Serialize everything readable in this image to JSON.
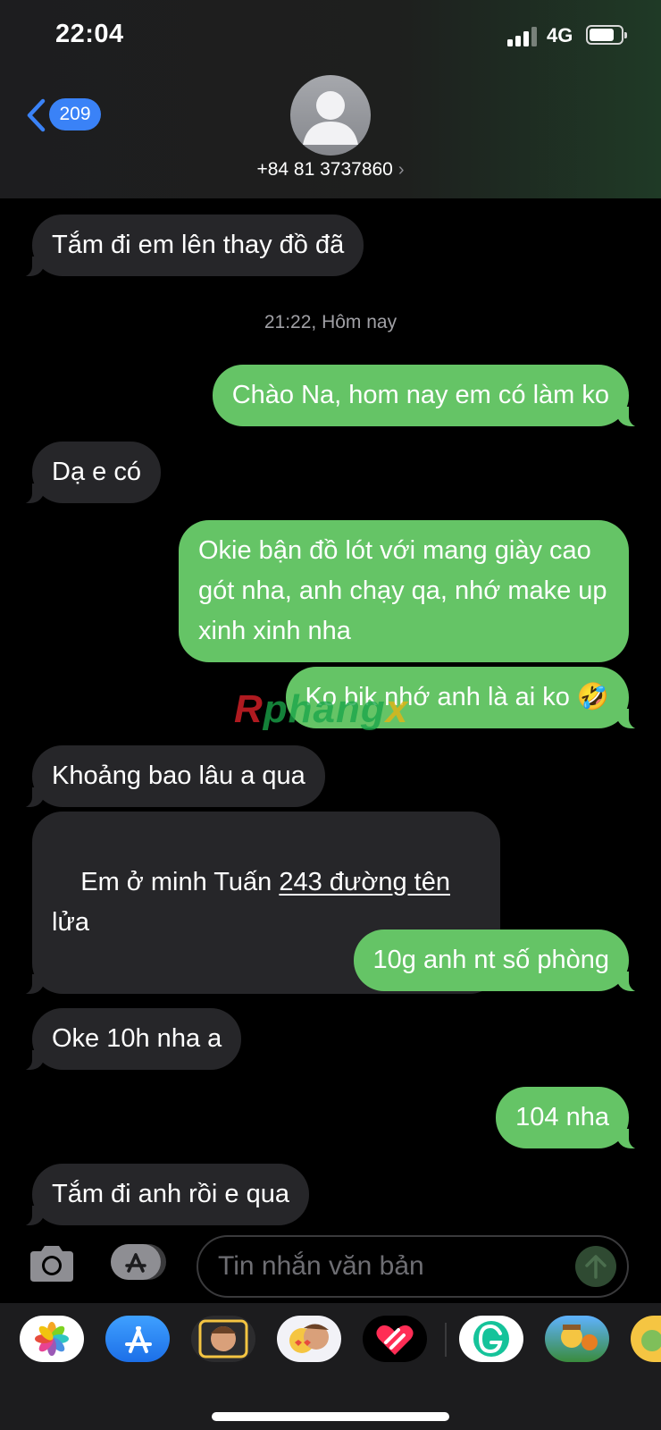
{
  "status": {
    "time": "22:04",
    "network": "4G"
  },
  "header": {
    "back_count": "209",
    "contact": "+84 81 3737860",
    "chevron": "›"
  },
  "messages": [
    {
      "side": "in",
      "text": "Tắm đi em lên thay đồ đã"
    },
    {
      "side": "out",
      "text": "Chào Na, hom nay em có làm ko"
    },
    {
      "side": "in",
      "text": "Dạ e có"
    },
    {
      "side": "out",
      "text": "Okie bận đồ lót với mang giày cao gót nha, anh chạy qa, nhớ make up xinh xinh nha"
    },
    {
      "side": "out",
      "text": "Ko bik nhớ anh là ai ko 🤣"
    },
    {
      "side": "in",
      "text": "Khoảng bao lâu a qua"
    },
    {
      "side": "in",
      "text_before": "Em ở minh Tuấn ",
      "text_link": "243 đường tên",
      "text_after": "lửa"
    },
    {
      "side": "out",
      "text": "10g anh nt số phòng"
    },
    {
      "side": "in",
      "text": "Oke 10h nha a"
    },
    {
      "side": "out",
      "text": "104 nha"
    },
    {
      "side": "in",
      "text": "Tắm đi anh rồi e qua"
    }
  ],
  "timestamp": "21:22, Hôm nay",
  "watermark": {
    "part1": "R",
    "part2": "phang",
    "part3": "x"
  },
  "input": {
    "placeholder": "Tin nhắn văn bản"
  },
  "apps": [
    "photos-app",
    "app-store-app",
    "memoji-app",
    "animoji-app",
    "digital-touch-app",
    "grammarly-app",
    "game-app",
    "sticker-app"
  ],
  "colors": {
    "outgoing": "#65c466",
    "incoming": "#262629",
    "accent": "#3a82f7"
  }
}
